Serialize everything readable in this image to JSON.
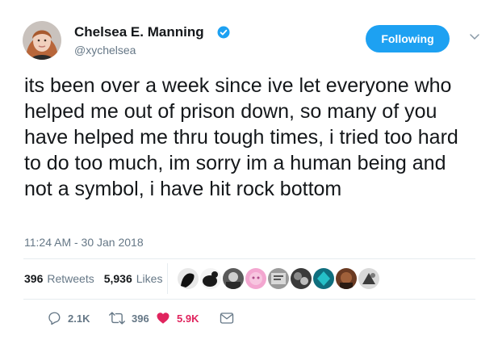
{
  "user": {
    "display_name": "Chelsea E. Manning",
    "handle": "@xychelsea",
    "verified_icon": "verified-badge-icon",
    "avatar": "profile-photo"
  },
  "follow_button": {
    "label": "Following"
  },
  "more_menu": {
    "icon": "chevron-down-icon"
  },
  "tweet": {
    "text": "its been over a week since ive let everyone who helped me out of prison down, so many of you have helped me thru tough times, i tried too hard to do too much, im sorry im a human being and not a symbol, i have hit rock bottom",
    "timestamp": "11:24 AM - 30 Jan 2018"
  },
  "stats": {
    "retweets_count": "396",
    "retweets_label": "Retweets",
    "likes_count": "5,936",
    "likes_label": "Likes",
    "liker_avatar_count": 9
  },
  "actions": {
    "reply_count": "2.1K",
    "retweet_count": "396",
    "like_count": "5.9K",
    "reply_icon": "reply-icon",
    "retweet_icon": "retweet-icon",
    "like_icon": "heart-icon",
    "dm_icon": "envelope-icon"
  },
  "colors": {
    "accent": "#1da1f2",
    "like": "#e0245e",
    "secondary_text": "#657786",
    "divider": "#e6ecf0"
  }
}
